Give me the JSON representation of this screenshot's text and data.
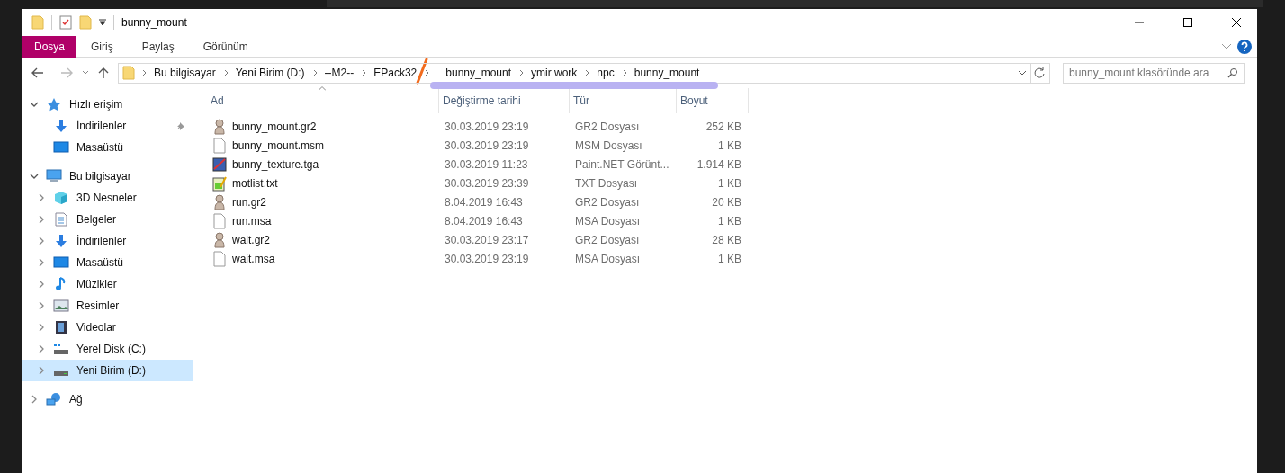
{
  "window": {
    "title": "bunny_mount"
  },
  "ribbon_tabs": [
    {
      "label": "Dosya",
      "selected": true
    },
    {
      "label": "Giriş",
      "selected": false
    },
    {
      "label": "Paylaş",
      "selected": false
    },
    {
      "label": "Görünüm",
      "selected": false
    }
  ],
  "address": {
    "segments": [
      "Bu bilgisayar",
      "Yeni Birim (D:)",
      "--M2--",
      "EPack32",
      "bunny_mount",
      "ymir work",
      "npc",
      "bunny_mount"
    ]
  },
  "search": {
    "placeholder": "bunny_mount klasöründe ara"
  },
  "sidebar": {
    "items": [
      {
        "label": "Hızlı erişim",
        "kind": "star",
        "expanded": true,
        "selected": false,
        "children": [
          {
            "label": "İndirilenler",
            "kind": "download",
            "pinned": true,
            "selected": false
          },
          {
            "label": "Masaüstü",
            "kind": "desktop",
            "pinned": false,
            "selected": false
          }
        ]
      },
      {
        "label": "Bu bilgisayar",
        "kind": "pc",
        "expanded": true,
        "selected": false,
        "children": [
          {
            "label": "3D Nesneler",
            "kind": "cube",
            "expanded": false,
            "selected": false
          },
          {
            "label": "Belgeler",
            "kind": "docs",
            "expanded": false,
            "selected": false
          },
          {
            "label": "İndirilenler",
            "kind": "download",
            "expanded": false,
            "selected": false
          },
          {
            "label": "Masaüstü",
            "kind": "desktop",
            "expanded": false,
            "selected": false
          },
          {
            "label": "Müzikler",
            "kind": "music",
            "expanded": false,
            "selected": false
          },
          {
            "label": "Resimler",
            "kind": "pictures",
            "expanded": false,
            "selected": false
          },
          {
            "label": "Videolar",
            "kind": "video",
            "expanded": false,
            "selected": false
          },
          {
            "label": "Yerel Disk (C:)",
            "kind": "disk",
            "expanded": false,
            "selected": false
          },
          {
            "label": "Yeni Birim (D:)",
            "kind": "drive",
            "expanded": false,
            "selected": true
          }
        ]
      },
      {
        "label": "Ağ",
        "kind": "network",
        "expanded": false,
        "selected": false
      }
    ]
  },
  "table": {
    "columns": [
      "Ad",
      "Değiştirme tarihi",
      "Tür",
      "Boyut"
    ],
    "rows": [
      {
        "kind": "model",
        "name": "bunny_mount.gr2",
        "date": "30.03.2019 23:19",
        "type": "GR2 Dosyası",
        "size": "252 KB"
      },
      {
        "kind": "blank",
        "name": "bunny_mount.msm",
        "date": "30.03.2019 23:19",
        "type": "MSM Dosyası",
        "size": "1 KB"
      },
      {
        "kind": "image",
        "name": "bunny_texture.tga",
        "date": "30.03.2019 11:23",
        "type": "Paint.NET Görünt...",
        "size": "1.914 KB"
      },
      {
        "kind": "text",
        "name": "motlist.txt",
        "date": "30.03.2019 23:39",
        "type": "TXT Dosyası",
        "size": "1 KB"
      },
      {
        "kind": "model",
        "name": "run.gr2",
        "date": "8.04.2019 16:43",
        "type": "GR2 Dosyası",
        "size": "20 KB"
      },
      {
        "kind": "blank",
        "name": "run.msa",
        "date": "8.04.2019 16:43",
        "type": "MSA Dosyası",
        "size": "1 KB"
      },
      {
        "kind": "model",
        "name": "wait.gr2",
        "date": "30.03.2019 23:17",
        "type": "GR2 Dosyası",
        "size": "28 KB"
      },
      {
        "kind": "blank",
        "name": "wait.msa",
        "date": "30.03.2019 23:19",
        "type": "MSA Dosyası",
        "size": "1 KB"
      }
    ]
  }
}
